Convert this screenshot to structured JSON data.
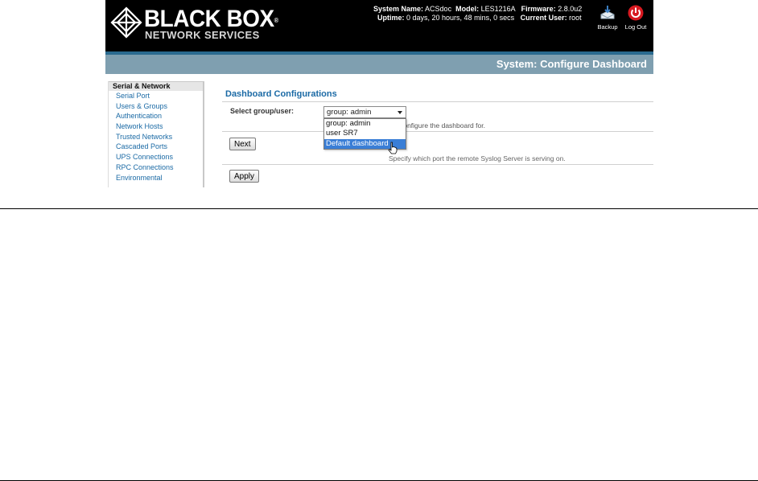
{
  "header": {
    "logo": {
      "main": "BLACK BOX",
      "registered": "®",
      "sub": "NETWORK SERVICES"
    },
    "system_info": {
      "system_name_label": "System Name:",
      "system_name": "ACSdoc",
      "model_label": "Model:",
      "model": "LES1216A",
      "firmware_label": "Firmware:",
      "firmware": "2.8.0u2",
      "uptime_label": "Uptime:",
      "uptime": "0 days, 20 hours, 48 mins, 0 secs",
      "current_user_label": "Current User:",
      "current_user": "root"
    },
    "buttons": [
      {
        "label": "Backup",
        "icon": "backup-icon"
      },
      {
        "label": "Log Out",
        "icon": "power-icon"
      }
    ]
  },
  "title_bar": {
    "title": "System: Configure Dashboard"
  },
  "sidebar": {
    "heading": "Serial & Network",
    "items": [
      {
        "label": "Serial Port"
      },
      {
        "label": "Users & Groups"
      },
      {
        "label": "Authentication"
      },
      {
        "label": "Network Hosts"
      },
      {
        "label": "Trusted Networks"
      },
      {
        "label": "Cascaded Ports"
      },
      {
        "label": "UPS Connections"
      },
      {
        "label": "RPC Connections"
      },
      {
        "label": "Environmental"
      }
    ]
  },
  "main": {
    "section_title": "Dashboard Configurations",
    "select_label": "Select group/user:",
    "select_value": "group: admin",
    "select_description": "o configure the dashboard for.",
    "dropdown_options": [
      {
        "label": "group: admin",
        "selected": false
      },
      {
        "label": "user SR7",
        "selected": false
      },
      {
        "label": "Default dashboard",
        "selected": true
      }
    ],
    "obscured_description": "Specify which port the remote Syslog Server is serving on.",
    "next_label": "Next",
    "apply_label": "Apply"
  },
  "colors": {
    "header_bg": "#000000",
    "title_bar_bg": "#7f9fb0",
    "link": "#1b6aa5",
    "selected_option": "#3a7ed6"
  }
}
